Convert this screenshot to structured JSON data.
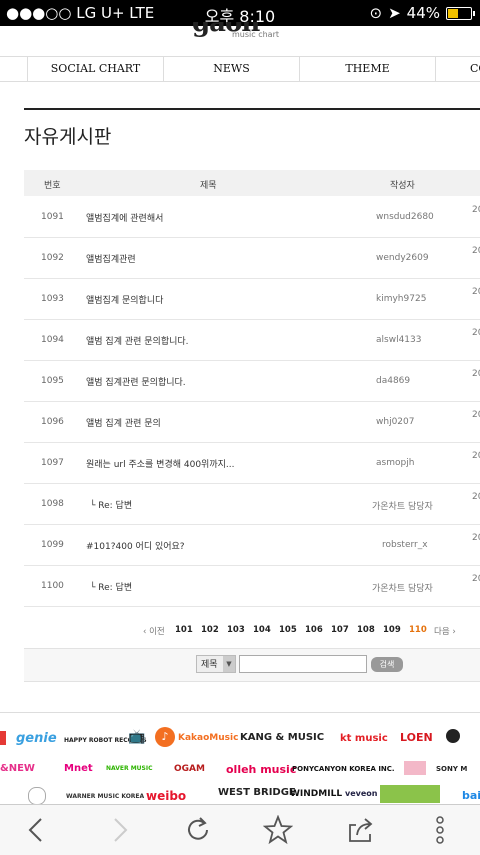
{
  "status": {
    "carrier": "●●●○○ LG U+  LTE",
    "time": "오후 8:10",
    "battery": "44%"
  },
  "logo": {
    "mark": "gaon",
    "sub": "music chart"
  },
  "nav": [
    "",
    "SOCIAL CHART",
    "NEWS",
    "THEME",
    "CO"
  ],
  "board_title": "자유게시판",
  "headers": {
    "num": "번호",
    "subject": "제목",
    "author": "작성자",
    "date": "20"
  },
  "posts": [
    {
      "num": "1091",
      "subject": "앨범집계에 관련해서",
      "author": "wnsdud2680",
      "date": "20"
    },
    {
      "num": "1092",
      "subject": "앨범집계관련",
      "author": "wendy2609",
      "date": "20"
    },
    {
      "num": "1093",
      "subject": "앨범집계 문의합니다",
      "author": "kimyh9725",
      "date": "20"
    },
    {
      "num": "1094",
      "subject": "앨범 집계 관련 문의합니다.",
      "author": "alswl4133",
      "date": "20"
    },
    {
      "num": "1095",
      "subject": "앨범 집계관련 문의합니다.",
      "author": "da4869",
      "date": "20"
    },
    {
      "num": "1096",
      "subject": "앨범 집계 관련 문의",
      "author": "whj0207",
      "date": "20"
    },
    {
      "num": "1097",
      "subject": "원래는 url 주소를 변경해 400위까지...",
      "author": "asmopjh",
      "date": "20"
    },
    {
      "num": "1098",
      "subject": "└ Re: 답변",
      "author": "가온차트 담당자",
      "date": "20"
    },
    {
      "num": "1099",
      "subject": "#101?400 어디 있어요?",
      "author": "robsterr_x",
      "date": "20"
    },
    {
      "num": "1100",
      "subject": "└ Re: 답변",
      "author": "가온차트 담당자",
      "date": "20"
    }
  ],
  "pagination": {
    "prev": "‹ 이전",
    "pages": [
      "101",
      "102",
      "103",
      "104",
      "105",
      "106",
      "107",
      "108",
      "109",
      "110"
    ],
    "current": "110",
    "next": "다음 ›"
  },
  "search": {
    "select_value": "제목",
    "input_value": "",
    "button": "검색"
  },
  "partners": {
    "row1": [
      "genie",
      "HAPPY ROBOT RECORDS",
      "KakaoMusic",
      "KANG & MUSIC",
      "kt music",
      "LOEN"
    ],
    "row2": [
      "&NEW",
      "Mnet",
      "NAVER MUSIC",
      "OGAM",
      "olleh music",
      "PONYCANYON KOREA INC.",
      "SONY M"
    ],
    "row3": [
      "WARNER MUSIC KOREA",
      "weibo",
      "WEST BRIDGE",
      "WINDMILL",
      "veveon media",
      "bai"
    ]
  },
  "colors": {
    "accent": "#e5720d",
    "status_bg": "#000000",
    "battery": "#f2c200"
  },
  "toolbar": {
    "icons": [
      "back-icon",
      "forward-icon",
      "reload-icon",
      "bookmark-star-icon",
      "share-icon",
      "more-icon"
    ]
  }
}
